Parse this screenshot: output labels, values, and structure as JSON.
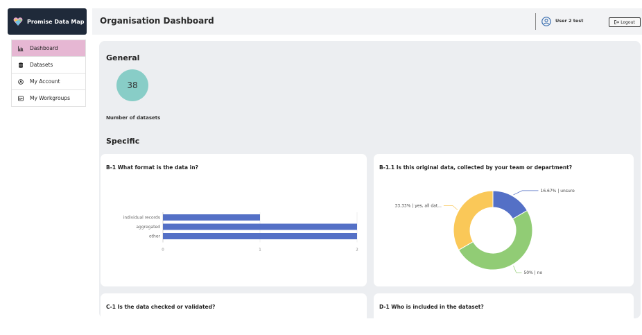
{
  "brand": {
    "name": "Promise Data Map"
  },
  "sidebar": {
    "items": [
      {
        "label": "Dashboard",
        "icon": "bar-chart-icon",
        "active": true
      },
      {
        "label": "Datasets",
        "icon": "database-icon",
        "active": false
      },
      {
        "label": "My Account",
        "icon": "account-icon",
        "active": false
      },
      {
        "label": "My Workgroups",
        "icon": "workgroups-icon",
        "active": false
      }
    ]
  },
  "header": {
    "title": "Organisation Dashboard",
    "user": "User 2 test",
    "logout_label": "Logout"
  },
  "general": {
    "heading": "General",
    "dataset_count": "38",
    "dataset_count_label": "Number of datasets"
  },
  "specific": {
    "heading": "Specific"
  },
  "colors": {
    "bar": "#5470c6",
    "pie_blue": "#5470c6",
    "pie_green": "#91cc75",
    "pie_yellow": "#fac858",
    "accent": "#e6b7d3",
    "circle": "#88cdc7"
  },
  "chart_data": [
    {
      "type": "bar",
      "title": "B-1 What format is the data in?",
      "orientation": "horizontal",
      "categories": [
        "individual records",
        "aggregated",
        "other"
      ],
      "values": [
        1,
        2,
        2
      ],
      "xlim": [
        0,
        2
      ],
      "xticks": [
        "0",
        "1",
        "2"
      ]
    },
    {
      "type": "pie",
      "title": "B-1.1 Is this original data, collected by your team or department?",
      "donut": true,
      "slices": [
        {
          "label": "16.67% | unsure",
          "value": 16.67,
          "color": "#5470c6"
        },
        {
          "label": "50% | no",
          "value": 50,
          "color": "#91cc75"
        },
        {
          "label": "33.33% | yes, all dat...",
          "value": 33.33,
          "color": "#fac858"
        }
      ]
    }
  ],
  "more_cards": [
    {
      "title": "C-1 Is the data checked or validated?"
    },
    {
      "title": "D-1 Who is included in the dataset?"
    }
  ]
}
